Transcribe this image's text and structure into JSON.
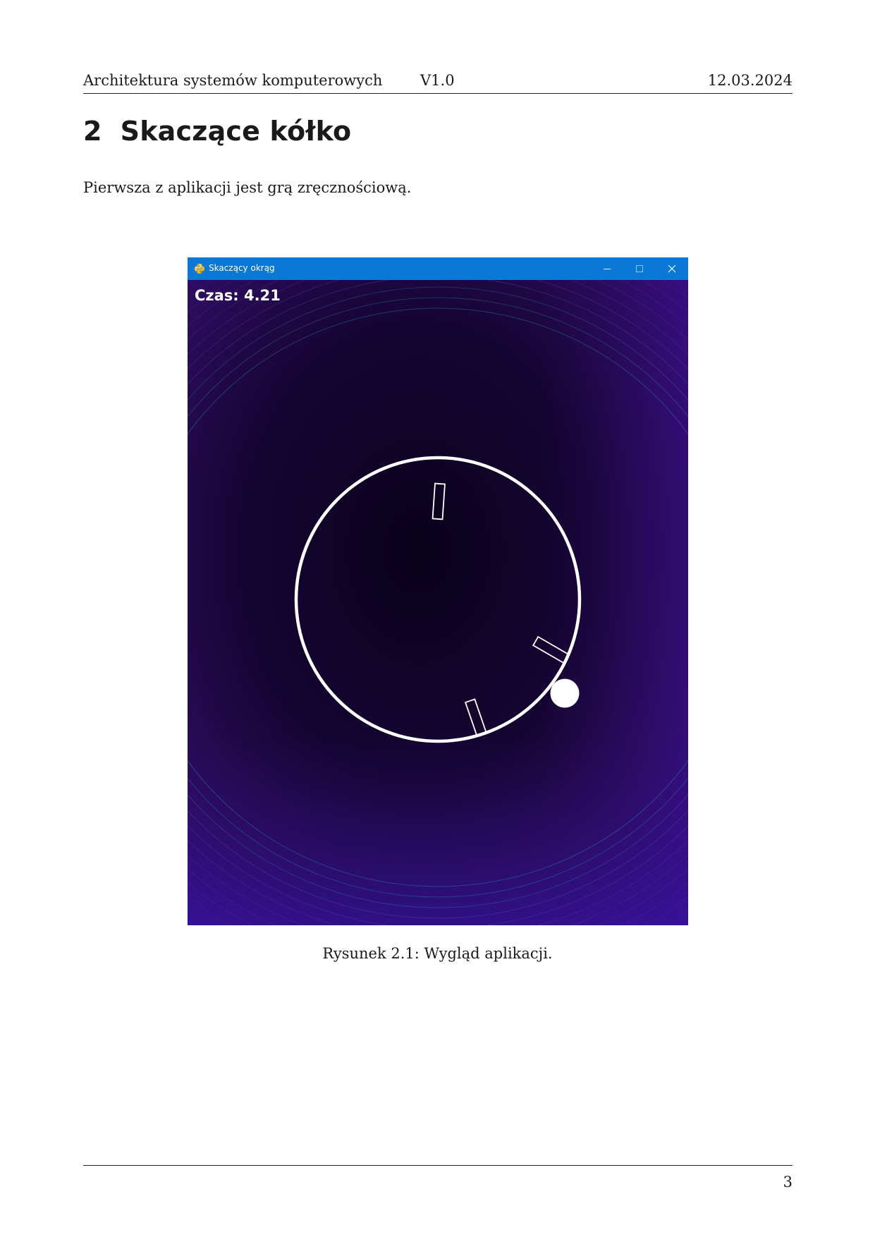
{
  "header": {
    "left": "Architektura systemów komputerowych",
    "middle": "V1.0",
    "right": "12.03.2024"
  },
  "section": {
    "number": "2",
    "title": "Skaczące kółko"
  },
  "paragraph": "Pierwsza z aplikacji jest grą zręcznościową.",
  "figure": {
    "window_title": "Skaczący okrąg",
    "timer_text": "Czas: 4.21",
    "icons": [
      "python-icon",
      "minimize-icon",
      "maximize-icon",
      "close-icon"
    ],
    "colors": {
      "titlebar": "#0a78d4",
      "background_dark": "#0a021c",
      "background_purple": "#3a0f7a",
      "ring": "#ffffff"
    },
    "caption": "Rysunek 2.1: Wygląd aplikacji."
  },
  "footer": {
    "page_number": "3"
  }
}
